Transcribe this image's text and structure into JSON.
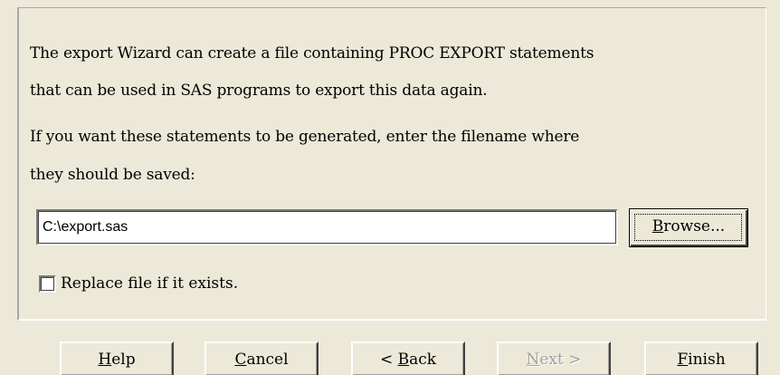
{
  "description": {
    "line1": "The export Wizard can create a file containing PROC EXPORT statements",
    "line2": "that can be used in SAS programs to export this data again.",
    "line3": "If you want these statements to be generated, enter the filename where",
    "line4": "they should be saved:"
  },
  "filename": {
    "value": "C:\\export.sas"
  },
  "browse": {
    "mnemonic": "B",
    "rest": "rowse..."
  },
  "replace": {
    "label": "Replace file if it exists.",
    "checked": false
  },
  "buttons": {
    "help": {
      "mnemonic": "H",
      "rest": "elp"
    },
    "cancel": {
      "mnemonic": "C",
      "rest": "ancel"
    },
    "back": {
      "prefix": "< ",
      "mnemonic": "B",
      "rest": "ack"
    },
    "next": {
      "mnemonic": "N",
      "rest": "ext >",
      "enabled": false
    },
    "finish": {
      "mnemonic": "F",
      "rest": "inish"
    }
  },
  "colors": {
    "dialog_background": "#ece9d8",
    "disabled_text": "#a0a0a0"
  }
}
